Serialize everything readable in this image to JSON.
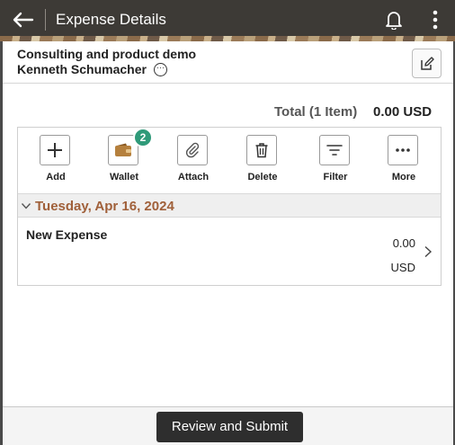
{
  "header": {
    "title": "Expense Details",
    "icons": {
      "back": "back-arrow-icon",
      "notifications": "bell-icon",
      "menu": "kebab-menu-icon"
    }
  },
  "report": {
    "name": "Consulting and product demo",
    "employee": "Kenneth Schumacher",
    "edit_icon": "edit-icon"
  },
  "total": {
    "label": "Total (1 Item)",
    "value": "0.00 USD"
  },
  "toolbar": {
    "items": [
      {
        "label": "Add",
        "icon": "plus-icon"
      },
      {
        "label": "Wallet",
        "icon": "wallet-icon",
        "badge": "2"
      },
      {
        "label": "Attach",
        "icon": "paperclip-icon"
      },
      {
        "label": "Delete",
        "icon": "trash-icon"
      },
      {
        "label": "Filter",
        "icon": "filter-icon"
      },
      {
        "label": "More",
        "icon": "more-icon"
      }
    ]
  },
  "groups": [
    {
      "date": "Tuesday, Apr 16, 2024",
      "expenses": [
        {
          "description": "New Expense",
          "amount": "0.00",
          "currency": "USD"
        }
      ]
    }
  ],
  "footer": {
    "submit_label": "Review and Submit"
  },
  "colors": {
    "header_bg": "#3d3a36",
    "date_text": "#a0603a",
    "badge": "#2f9a79",
    "submit_bg": "#2e2e2e"
  }
}
